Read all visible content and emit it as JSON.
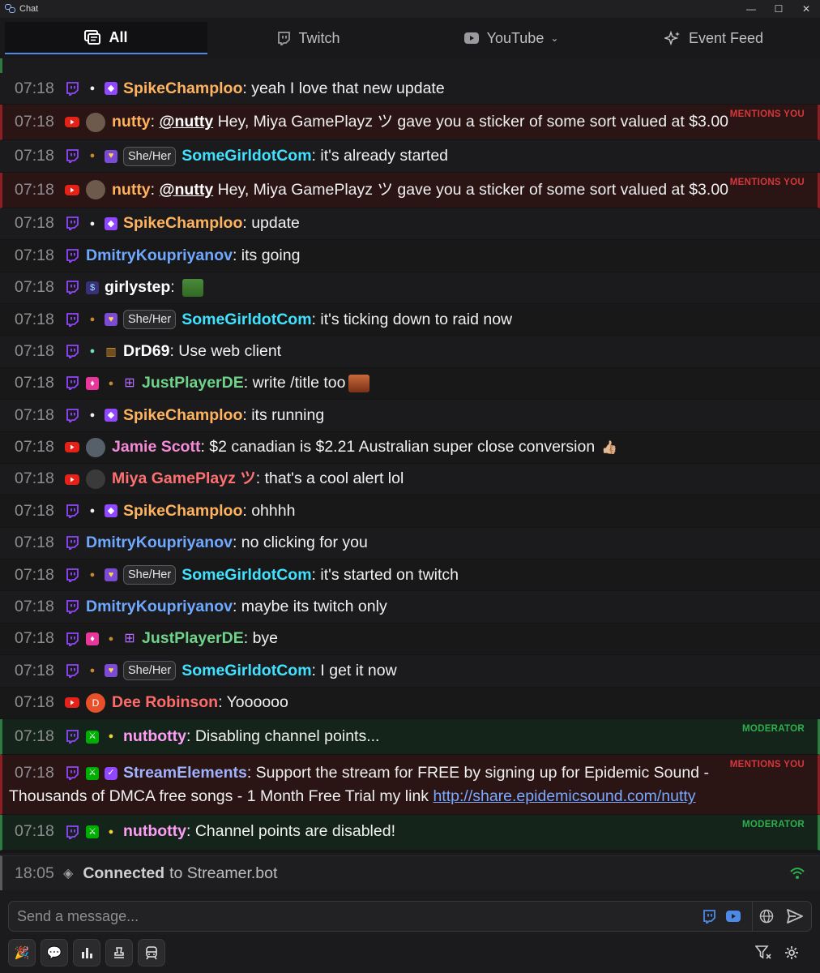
{
  "window": {
    "title": "Chat",
    "controls": [
      "—",
      "☐",
      "✕"
    ]
  },
  "tabs": [
    {
      "label": "All",
      "active": true,
      "icon": "chat-all-icon"
    },
    {
      "label": "Twitch",
      "active": false,
      "icon": "twitch-icon"
    },
    {
      "label": "YouTube",
      "active": false,
      "icon": "youtube-icon"
    },
    {
      "label": "Event Feed",
      "active": false,
      "icon": "sparkle-icon"
    }
  ],
  "colors": {
    "accent": "#4d8ae8",
    "twitch": "#9146ff",
    "youtube": "#e62117",
    "mention": "#d4373c",
    "moderator": "#2fae4e"
  },
  "messages": [
    {
      "time": "07:18",
      "platform": "twitch",
      "badges": [
        "acorn-white",
        "twitch-purple"
      ],
      "user": "SpikeChamploo",
      "color": "#ffb35e",
      "text": ": yeah I love that new update",
      "style": "even"
    },
    {
      "time": "07:18",
      "platform": "youtube",
      "avatar": true,
      "avatar_color": "#6d5a4c",
      "user": "nutty",
      "color": "#ffb35e",
      "mention": "@nutty",
      "text": " Hey, Miya GamePlayz ツ gave you a sticker of some sort valued at $3.00",
      "style": "mention",
      "tag": "MENTIONS YOU"
    },
    {
      "time": "07:18",
      "platform": "twitch",
      "badges": [
        "acorn-brown",
        "heart"
      ],
      "pronoun": "She/Her",
      "user": "SomeGirldotCom",
      "color": "#41e2ff",
      "text": ": it's already started",
      "style": "even"
    },
    {
      "time": "07:18",
      "platform": "youtube",
      "avatar": true,
      "avatar_color": "#6d5a4c",
      "user": "nutty",
      "color": "#ffb35e",
      "mention": "@nutty",
      "text": " Hey, Miya GamePlayz ツ gave you a sticker of some sort valued at $3.00",
      "style": "mention",
      "tag": "MENTIONS YOU"
    },
    {
      "time": "07:18",
      "platform": "twitch",
      "badges": [
        "acorn-white",
        "twitch-purple"
      ],
      "user": "SpikeChamploo",
      "color": "#ffb35e",
      "text": ": update",
      "style": "even"
    },
    {
      "time": "07:18",
      "platform": "twitch",
      "user": "DmitryKoupriyanov",
      "color": "#6fa8ff",
      "text": ": its going",
      "style": "odd"
    },
    {
      "time": "07:18",
      "platform": "twitch",
      "badges": [
        "sub"
      ],
      "user": "girlystep",
      "color": "#ffffff",
      "text": ": ",
      "emote": "pepe",
      "style": "even"
    },
    {
      "time": "07:18",
      "platform": "twitch",
      "badges": [
        "acorn-brown",
        "heart"
      ],
      "pronoun": "She/Her",
      "user": "SomeGirldotCom",
      "color": "#41e2ff",
      "text": ": it's ticking down to raid now",
      "style": "odd"
    },
    {
      "time": "07:18",
      "platform": "twitch",
      "badges": [
        "acorn-teal",
        "bits"
      ],
      "user": "DrD69",
      "color": "#ffffff",
      "text": ": Use web client",
      "style": "even"
    },
    {
      "time": "07:18",
      "platform": "twitch",
      "badges": [
        "gem",
        "acorn-brown",
        "gift"
      ],
      "user": "JustPlayerDE",
      "color": "#6fd48a",
      "text": ": write /title too",
      "emote": "face",
      "style": "odd"
    },
    {
      "time": "07:18",
      "platform": "twitch",
      "badges": [
        "acorn-white",
        "twitch-purple"
      ],
      "user": "SpikeChamploo",
      "color": "#ffb35e",
      "text": ": its running",
      "style": "even"
    },
    {
      "time": "07:18",
      "platform": "youtube",
      "avatar": true,
      "avatar_color": "#55606b",
      "user": "Jamie Scott",
      "color": "#f48ad8",
      "text": ": $2 canadian is $2.21 Australian super close conversion",
      "thumb": "👍🏼",
      "style": "odd"
    },
    {
      "time": "07:18",
      "platform": "youtube",
      "avatar": true,
      "avatar_color": "#3a3a3a",
      "user": "Miya GamePlayz ツ",
      "color": "#ff7070",
      "text": ": that's a cool alert lol",
      "style": "even"
    },
    {
      "time": "07:18",
      "platform": "twitch",
      "badges": [
        "acorn-white",
        "twitch-purple"
      ],
      "user": "SpikeChamploo",
      "color": "#ffb35e",
      "text": ": ohhhh",
      "style": "odd"
    },
    {
      "time": "07:18",
      "platform": "twitch",
      "user": "DmitryKoupriyanov",
      "color": "#6fa8ff",
      "text": ": no clicking for you",
      "style": "even"
    },
    {
      "time": "07:18",
      "platform": "twitch",
      "badges": [
        "acorn-brown",
        "heart"
      ],
      "pronoun": "She/Her",
      "user": "SomeGirldotCom",
      "color": "#41e2ff",
      "text": ": it's started on twitch",
      "style": "odd"
    },
    {
      "time": "07:18",
      "platform": "twitch",
      "user": "DmitryKoupriyanov",
      "color": "#6fa8ff",
      "text": ": maybe its twitch only",
      "style": "even"
    },
    {
      "time": "07:18",
      "platform": "twitch",
      "badges": [
        "gem",
        "acorn-brown",
        "gift"
      ],
      "user": "JustPlayerDE",
      "color": "#6fd48a",
      "text": ": bye",
      "style": "odd"
    },
    {
      "time": "07:18",
      "platform": "twitch",
      "badges": [
        "acorn-brown",
        "heart"
      ],
      "pronoun": "She/Her",
      "user": "SomeGirldotCom",
      "color": "#41e2ff",
      "text": ": I get it now",
      "style": "even"
    },
    {
      "time": "07:18",
      "platform": "youtube",
      "avatar": true,
      "avatar_color": "#e8502a",
      "avatar_letter": "D",
      "user": "Dee Robinson",
      "color": "#ff6b6b",
      "text": ": Yoooooo",
      "style": "odd"
    },
    {
      "time": "07:18",
      "platform": "twitch",
      "badges": [
        "mod",
        "acorn-yellow"
      ],
      "user": "nutbotty",
      "color": "#ff9cf5",
      "text": ": Disabling channel points...",
      "style": "mod",
      "tag": "MODERATOR"
    },
    {
      "time": "07:18",
      "platform": "twitch",
      "badges": [
        "mod",
        "verified"
      ],
      "user": "StreamElements",
      "color": "#9fb2ff",
      "text": ": Support the stream for FREE by signing up for Epidemic Sound -",
      "text2": "Thousands of DMCA free songs - 1 Month Free Trial my link ",
      "link": "http://share.epidemicsound.com/nutty",
      "style": "mention wrap",
      "tag": "MENTIONS YOU"
    },
    {
      "time": "07:18",
      "platform": "twitch",
      "badges": [
        "mod",
        "acorn-yellow"
      ],
      "user": "nutbotty",
      "color": "#ff9cf5",
      "text": ": Channel points are disabled!",
      "style": "mod",
      "tag": "MODERATOR"
    }
  ],
  "status": {
    "time": "18:05",
    "strong": "Connected",
    "rest": "to Streamer.bot"
  },
  "composer": {
    "placeholder": "Send a message..."
  },
  "toolbar": [
    "party-popper-icon",
    "chat-bubble-icon",
    "bar-chart-icon",
    "stamp-icon",
    "train-icon"
  ]
}
